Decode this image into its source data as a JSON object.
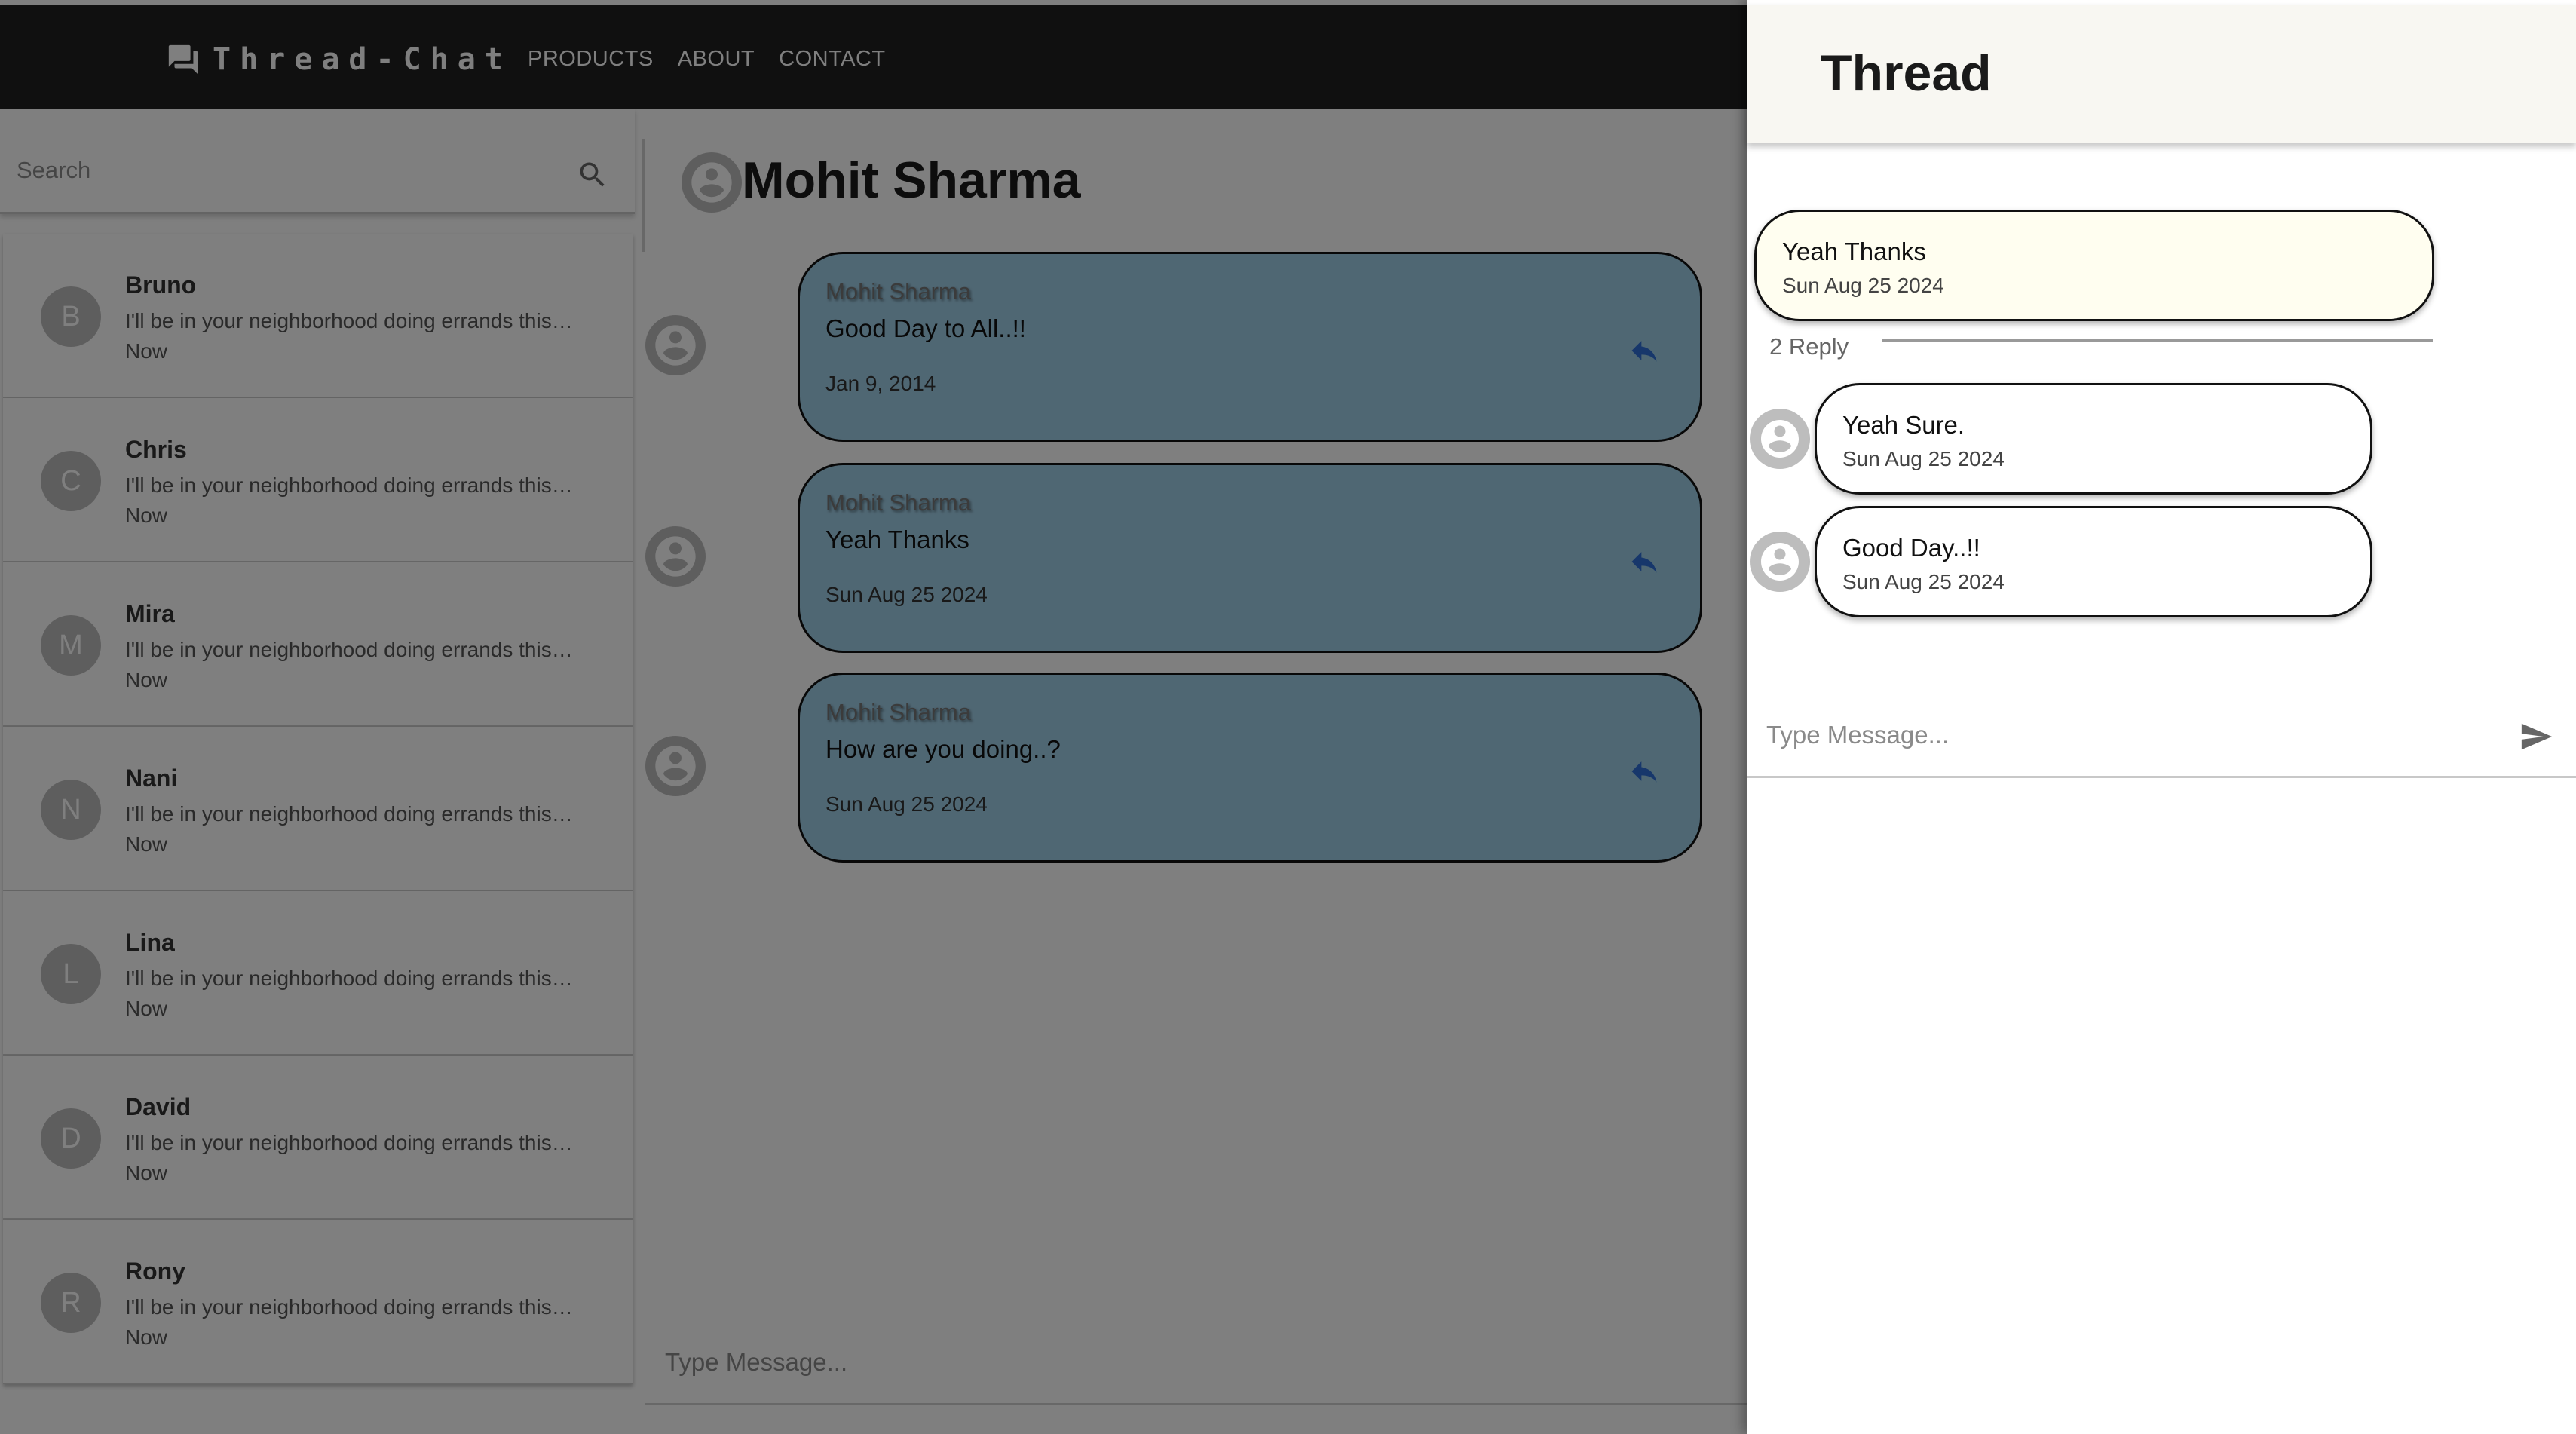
{
  "app": {
    "brand": "Thread-Chat",
    "nav": [
      "PRODUCTS",
      "ABOUT",
      "CONTACT"
    ]
  },
  "sidebar": {
    "search_placeholder": "Search",
    "contacts": [
      {
        "initial": "B",
        "name": "Bruno",
        "preview": "I'll be in your neighborhood doing errands this…",
        "time": "Now"
      },
      {
        "initial": "C",
        "name": "Chris",
        "preview": "I'll be in your neighborhood doing errands this…",
        "time": "Now"
      },
      {
        "initial": "M",
        "name": "Mira",
        "preview": "I'll be in your neighborhood doing errands this…",
        "time": "Now"
      },
      {
        "initial": "N",
        "name": "Nani",
        "preview": "I'll be in your neighborhood doing errands this…",
        "time": "Now"
      },
      {
        "initial": "L",
        "name": "Lina",
        "preview": "I'll be in your neighborhood doing errands this…",
        "time": "Now"
      },
      {
        "initial": "D",
        "name": "David",
        "preview": "I'll be in your neighborhood doing errands this…",
        "time": "Now"
      },
      {
        "initial": "R",
        "name": "Rony",
        "preview": "I'll be in your neighborhood doing errands this…",
        "time": "Now"
      }
    ]
  },
  "chat": {
    "title": "Mohit Sharma",
    "messages": [
      {
        "sender": "Mohit Sharma",
        "text": "Good Day to All..!!",
        "date": "Jan 9, 2014"
      },
      {
        "sender": "Mohit Sharma",
        "text": "Yeah Thanks",
        "date": "Sun Aug 25 2024"
      },
      {
        "sender": "Mohit Sharma",
        "text": "How are you doing..?",
        "date": "Sun Aug 25 2024"
      }
    ],
    "input_placeholder": "Type Message..."
  },
  "thread": {
    "title": "Thread",
    "parent": {
      "text": "Yeah Thanks",
      "date": "Sun Aug 25 2024"
    },
    "reply_count_label": "2 Reply",
    "replies": [
      {
        "text": "Yeah Sure.",
        "date": "Sun Aug 25 2024"
      },
      {
        "text": "Good Day..!!",
        "date": "Sun Aug 25 2024"
      }
    ],
    "input_placeholder": "Type Message..."
  },
  "colors": {
    "appbar": "#212121",
    "bubble": "#9fcee6",
    "thread_parent_bubble": "#fffef0",
    "thread_header": "#f8f7f2",
    "reply_icon": "#2f6fd6"
  },
  "icons": {
    "brand": "forum-icon",
    "search": "search-icon",
    "reply": "reply-icon",
    "avatar": "account-circle-icon",
    "send": "send-icon"
  }
}
